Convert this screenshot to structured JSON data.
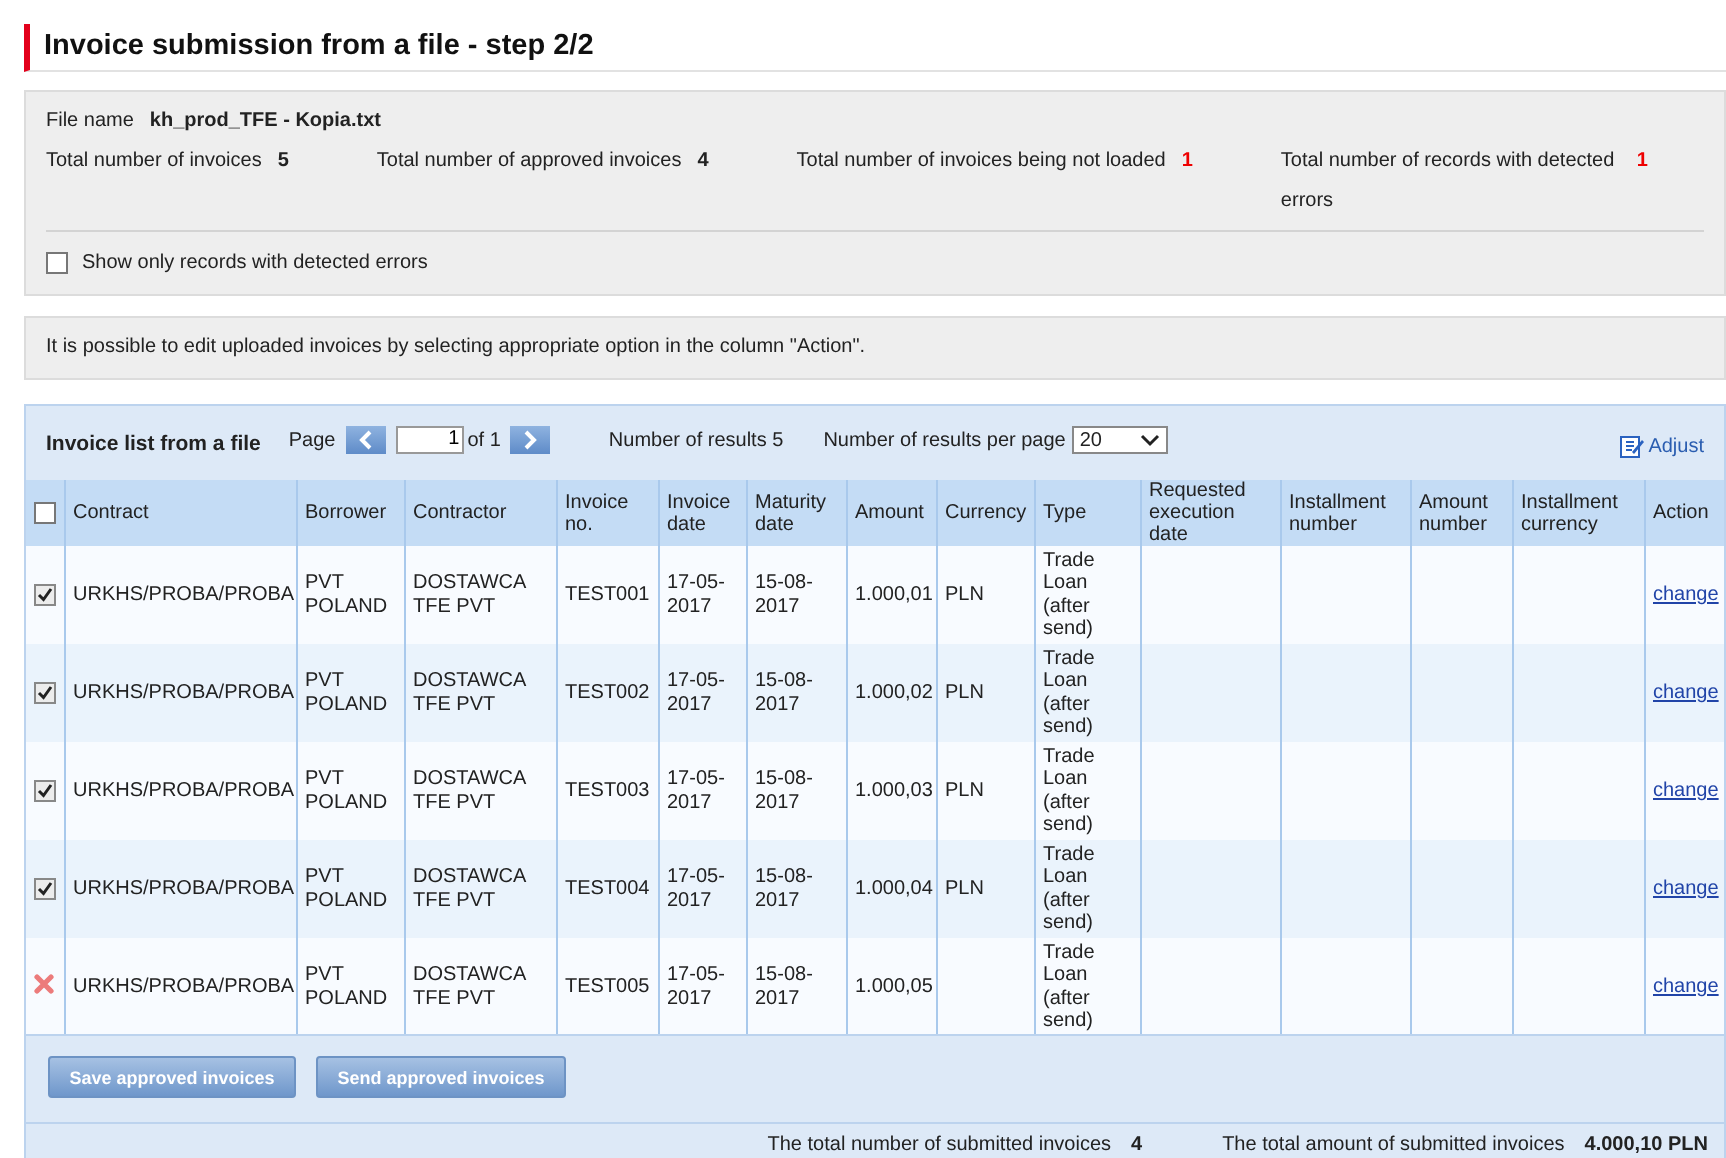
{
  "page": {
    "title": "Invoice submission from a file - step 2/2"
  },
  "summary": {
    "file_name_label": "File name",
    "file_name": "kh_prod_TFE - Kopia.txt",
    "stats": [
      {
        "label": "Total number of invoices",
        "value": "5",
        "alert": false
      },
      {
        "label": "Total number of approved invoices",
        "value": "4",
        "alert": false
      },
      {
        "label": "Total number of invoices being not loaded",
        "value": "1",
        "alert": true
      },
      {
        "label": "Total number of records with detected errors",
        "value": "1",
        "alert": true
      }
    ],
    "filter": {
      "label": "Show only records with detected errors",
      "checked": false
    }
  },
  "notice": "It is possible to edit uploaded invoices by selecting appropriate option in the column \"Action\".",
  "invoice_list": {
    "title": "Invoice list from a file",
    "page_label": "Page",
    "page": "1",
    "of_pages": "of 1",
    "results": "Number of results 5",
    "per_page_label": "Number of results per page",
    "per_page": "20",
    "adjust": "Adjust",
    "select_all_checked": false,
    "columns": [
      "Contract",
      "Borrower",
      "Contractor",
      "Invoice no.",
      "Invoice date",
      "Maturity date",
      "Amount",
      "Currency",
      "Type",
      "Requested execution date",
      "Installment number",
      "Amount number",
      "Installment currency",
      "Action"
    ],
    "rows": [
      {
        "kind": "checkbox",
        "checked": true,
        "contract": "URKHS/PROBA/PROBA",
        "borrower": "PVT POLAND",
        "contractor": "DOSTAWCA TFE PVT",
        "invoice_no": "TEST001",
        "invoice_date": "17-05-2017",
        "maturity_date": "15-08-2017",
        "amount": "1.000,01",
        "currency": "PLN",
        "type": "Trade Loan (after send)",
        "action": "change"
      },
      {
        "kind": "checkbox",
        "checked": true,
        "contract": "URKHS/PROBA/PROBA",
        "borrower": "PVT POLAND",
        "contractor": "DOSTAWCA TFE PVT",
        "invoice_no": "TEST002",
        "invoice_date": "17-05-2017",
        "maturity_date": "15-08-2017",
        "amount": "1.000,02",
        "currency": "PLN",
        "type": "Trade Loan (after send)",
        "action": "change"
      },
      {
        "kind": "checkbox",
        "checked": true,
        "contract": "URKHS/PROBA/PROBA",
        "borrower": "PVT POLAND",
        "contractor": "DOSTAWCA TFE PVT",
        "invoice_no": "TEST003",
        "invoice_date": "17-05-2017",
        "maturity_date": "15-08-2017",
        "amount": "1.000,03",
        "currency": "PLN",
        "type": "Trade Loan (after send)",
        "action": "change"
      },
      {
        "kind": "checkbox",
        "checked": true,
        "contract": "URKHS/PROBA/PROBA",
        "borrower": "PVT POLAND",
        "contractor": "DOSTAWCA TFE PVT",
        "invoice_no": "TEST004",
        "invoice_date": "17-05-2017",
        "maturity_date": "15-08-2017",
        "amount": "1.000,04",
        "currency": "PLN",
        "type": "Trade Loan (after send)",
        "action": "change"
      },
      {
        "kind": "error",
        "contract": "URKHS/PROBA/PROBA",
        "borrower": "PVT POLAND",
        "contractor": "DOSTAWCA TFE PVT",
        "invoice_no": "TEST005",
        "invoice_date": "17-05-2017",
        "maturity_date": "15-08-2017",
        "amount": "1.000,05",
        "type": "Trade Loan (after send)",
        "action": "change"
      }
    ]
  },
  "buttons": [
    "Save approved invoices",
    "Send approved invoices"
  ],
  "totals": [
    {
      "label": "The total number of submitted invoices",
      "value": "4"
    },
    {
      "label": "The total amount of submitted invoices",
      "value": "4.000,10 PLN"
    }
  ]
}
